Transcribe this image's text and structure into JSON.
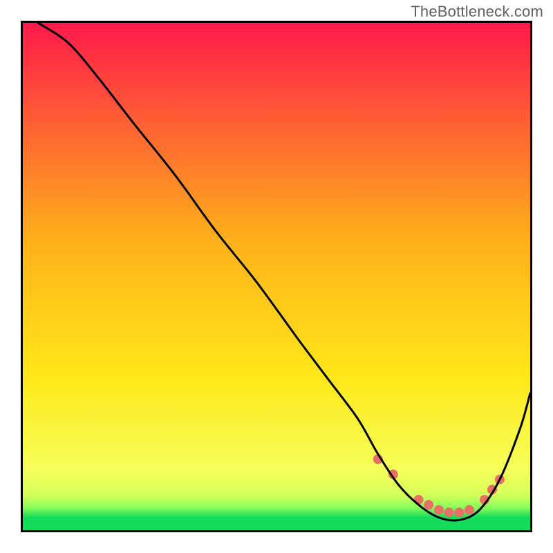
{
  "watermark": "TheBottleneck.com",
  "colors": {
    "gradient_top": "#ff1a4a",
    "gradient_upper_mid": "#ff9a1a",
    "gradient_mid": "#ffe81a",
    "gradient_lower": "#f6ff5a",
    "gradient_green": "#14db5a",
    "curve": "#000000",
    "dot_fill": "#e97066",
    "border": "#000000"
  },
  "chart_data": {
    "type": "line",
    "title": "",
    "xlabel": "",
    "ylabel": "",
    "xlim": [
      0,
      100
    ],
    "ylim": [
      0,
      100
    ],
    "series": [
      {
        "name": "bottleneck-curve",
        "x": [
          3,
          9,
          15,
          22,
          30,
          38,
          46,
          54,
          60,
          66,
          70,
          74,
          78,
          82,
          86,
          90,
          94,
          98,
          100
        ],
        "y": [
          100,
          96,
          89,
          80,
          70,
          59,
          49,
          38,
          30,
          22,
          15,
          9,
          5,
          2.5,
          2,
          4,
          10,
          20,
          27
        ]
      }
    ],
    "dots": {
      "name": "highlight-dots",
      "points": [
        {
          "x": 70,
          "y": 14
        },
        {
          "x": 73,
          "y": 11
        },
        {
          "x": 78,
          "y": 6
        },
        {
          "x": 80,
          "y": 5
        },
        {
          "x": 82,
          "y": 4
        },
        {
          "x": 84,
          "y": 3.5
        },
        {
          "x": 86,
          "y": 3.5
        },
        {
          "x": 88,
          "y": 4
        },
        {
          "x": 91,
          "y": 6
        },
        {
          "x": 92.5,
          "y": 8
        },
        {
          "x": 94,
          "y": 10
        }
      ],
      "radius": 7
    },
    "gradient_stops": [
      {
        "offset": 0,
        "color": "#ff1a4a"
      },
      {
        "offset": 0.43,
        "color": "#ffb11a"
      },
      {
        "offset": 0.7,
        "color": "#ffe81a"
      },
      {
        "offset": 0.88,
        "color": "#f6ff5a"
      },
      {
        "offset": 0.93,
        "color": "#d6ff5a"
      },
      {
        "offset": 0.955,
        "color": "#8aff5a"
      },
      {
        "offset": 0.975,
        "color": "#14db5a"
      },
      {
        "offset": 1.0,
        "color": "#14db5a"
      }
    ]
  }
}
